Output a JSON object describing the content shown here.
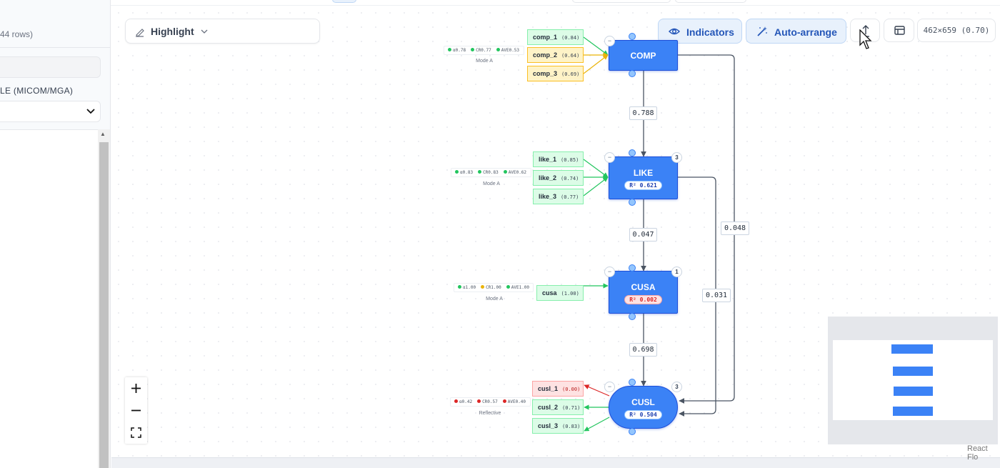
{
  "sidebar": {
    "rows_count": "44 rows)",
    "section_label": "LE (MICOM/MGA)"
  },
  "toolbar": {
    "highlight_label": "Highlight",
    "indicators_label": "Indicators",
    "auto_arrange_label": "Auto-arrange",
    "size_readout": "462×659 (0.70)"
  },
  "constructs": {
    "comp": {
      "name": "COMP"
    },
    "like": {
      "name": "LIKE",
      "r2": "R² 0.621",
      "count": "3"
    },
    "cusa": {
      "name": "CUSA",
      "r2": "R² 0.002",
      "count": "1"
    },
    "cusl": {
      "name": "CUSL",
      "r2": "R² 0.504",
      "count": "3"
    }
  },
  "indicators": {
    "comp_1": {
      "name": "comp_1",
      "loading": "(0.84)"
    },
    "comp_2": {
      "name": "comp_2",
      "loading": "(0.64)"
    },
    "comp_3": {
      "name": "comp_3",
      "loading": "(0.69)"
    },
    "like_1": {
      "name": "like_1",
      "loading": "(0.85)"
    },
    "like_2": {
      "name": "like_2",
      "loading": "(0.74)"
    },
    "like_3": {
      "name": "like_3",
      "loading": "(0.77)"
    },
    "cusa": {
      "name": "cusa",
      "loading": "(1.00)"
    },
    "cusl_1": {
      "name": "cusl_1",
      "loading": "(0.00)"
    },
    "cusl_2": {
      "name": "cusl_2",
      "loading": "(0.71)"
    },
    "cusl_3": {
      "name": "cusl_3",
      "loading": "(0.83)"
    }
  },
  "metrics": {
    "comp": {
      "alpha": "α0.78",
      "cr": "CR0.77",
      "ave": "AVE0.53",
      "mode": "Mode A"
    },
    "like": {
      "alpha": "α0.83",
      "cr": "CR0.83",
      "ave": "AVE0.62",
      "mode": "Mode A"
    },
    "cusa": {
      "alpha": "α1.00",
      "cr": "CR1.00",
      "ave": "AVE1.00",
      "mode": "Mode A"
    },
    "cusl": {
      "alpha": "α0.42",
      "cr": "CR0.57",
      "ave": "AVE0.40",
      "mode": "Reflective"
    }
  },
  "paths": {
    "comp_like": "0.788",
    "like_cusa": "0.047",
    "cusa_cusl": "0.698",
    "comp_cusl": "0.048",
    "like_cusl": "0.031"
  },
  "colors": {
    "construct_fill": "#3b82f6",
    "construct_border": "#1d4ed8",
    "indicator_good": "#dcfce7",
    "indicator_warn": "#fef3c7",
    "indicator_bad": "#fee2e2",
    "toolbar_accent": "#2456b8"
  },
  "attribution": "React Flo",
  "icons": [
    "pen-icon",
    "chevron-down-icon",
    "eye-icon",
    "magic-wand-icon",
    "export-icon",
    "layout-icon",
    "plus-icon",
    "minus-icon",
    "fit-view-icon",
    "mouse-cursor-icon"
  ]
}
